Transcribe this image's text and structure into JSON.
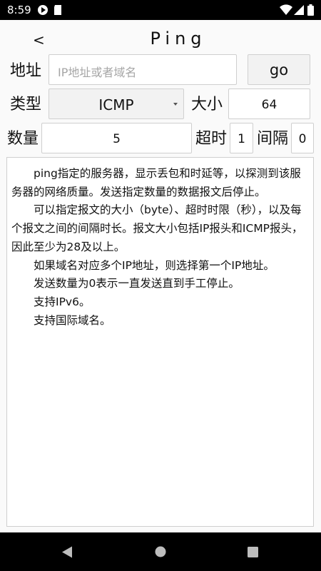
{
  "status_bar": {
    "time": "8:59",
    "icons": [
      "media-icon",
      "sd-card-icon",
      "wifi-icon",
      "signal-icon",
      "battery-icon"
    ]
  },
  "header": {
    "back_label": "<",
    "title": "Ping"
  },
  "form": {
    "address_label": "地址",
    "address_placeholder": "IP地址或者域名",
    "address_value": "",
    "go_label": "go",
    "type_label": "类型",
    "type_value": "ICMP",
    "size_label": "大小",
    "size_value": "64",
    "count_label": "数量",
    "count_value": "5",
    "timeout_label": "超时",
    "timeout_value": "1",
    "interval_label": "间隔",
    "interval_value": "0"
  },
  "description": {
    "paragraphs": [
      "ping指定的服务器，显示丢包和时延等，以探测到该服务器的网络质量。发送指定数量的数据报文后停止。",
      "可以指定报文的大小（byte）、超时时限（秒），以及每个报文之间的间隔时长。报文大小包括IP报头和ICMP报头，因此至少为28及以上。",
      "如果域名对应多个IP地址，则选择第一个IP地址。",
      "发送数量为0表示一直发送直到手工停止。",
      "支持IPv6。",
      "支持国际域名。"
    ]
  },
  "nav_bar": {
    "icons": [
      "back-triangle-icon",
      "home-circle-icon",
      "recents-square-icon"
    ]
  }
}
